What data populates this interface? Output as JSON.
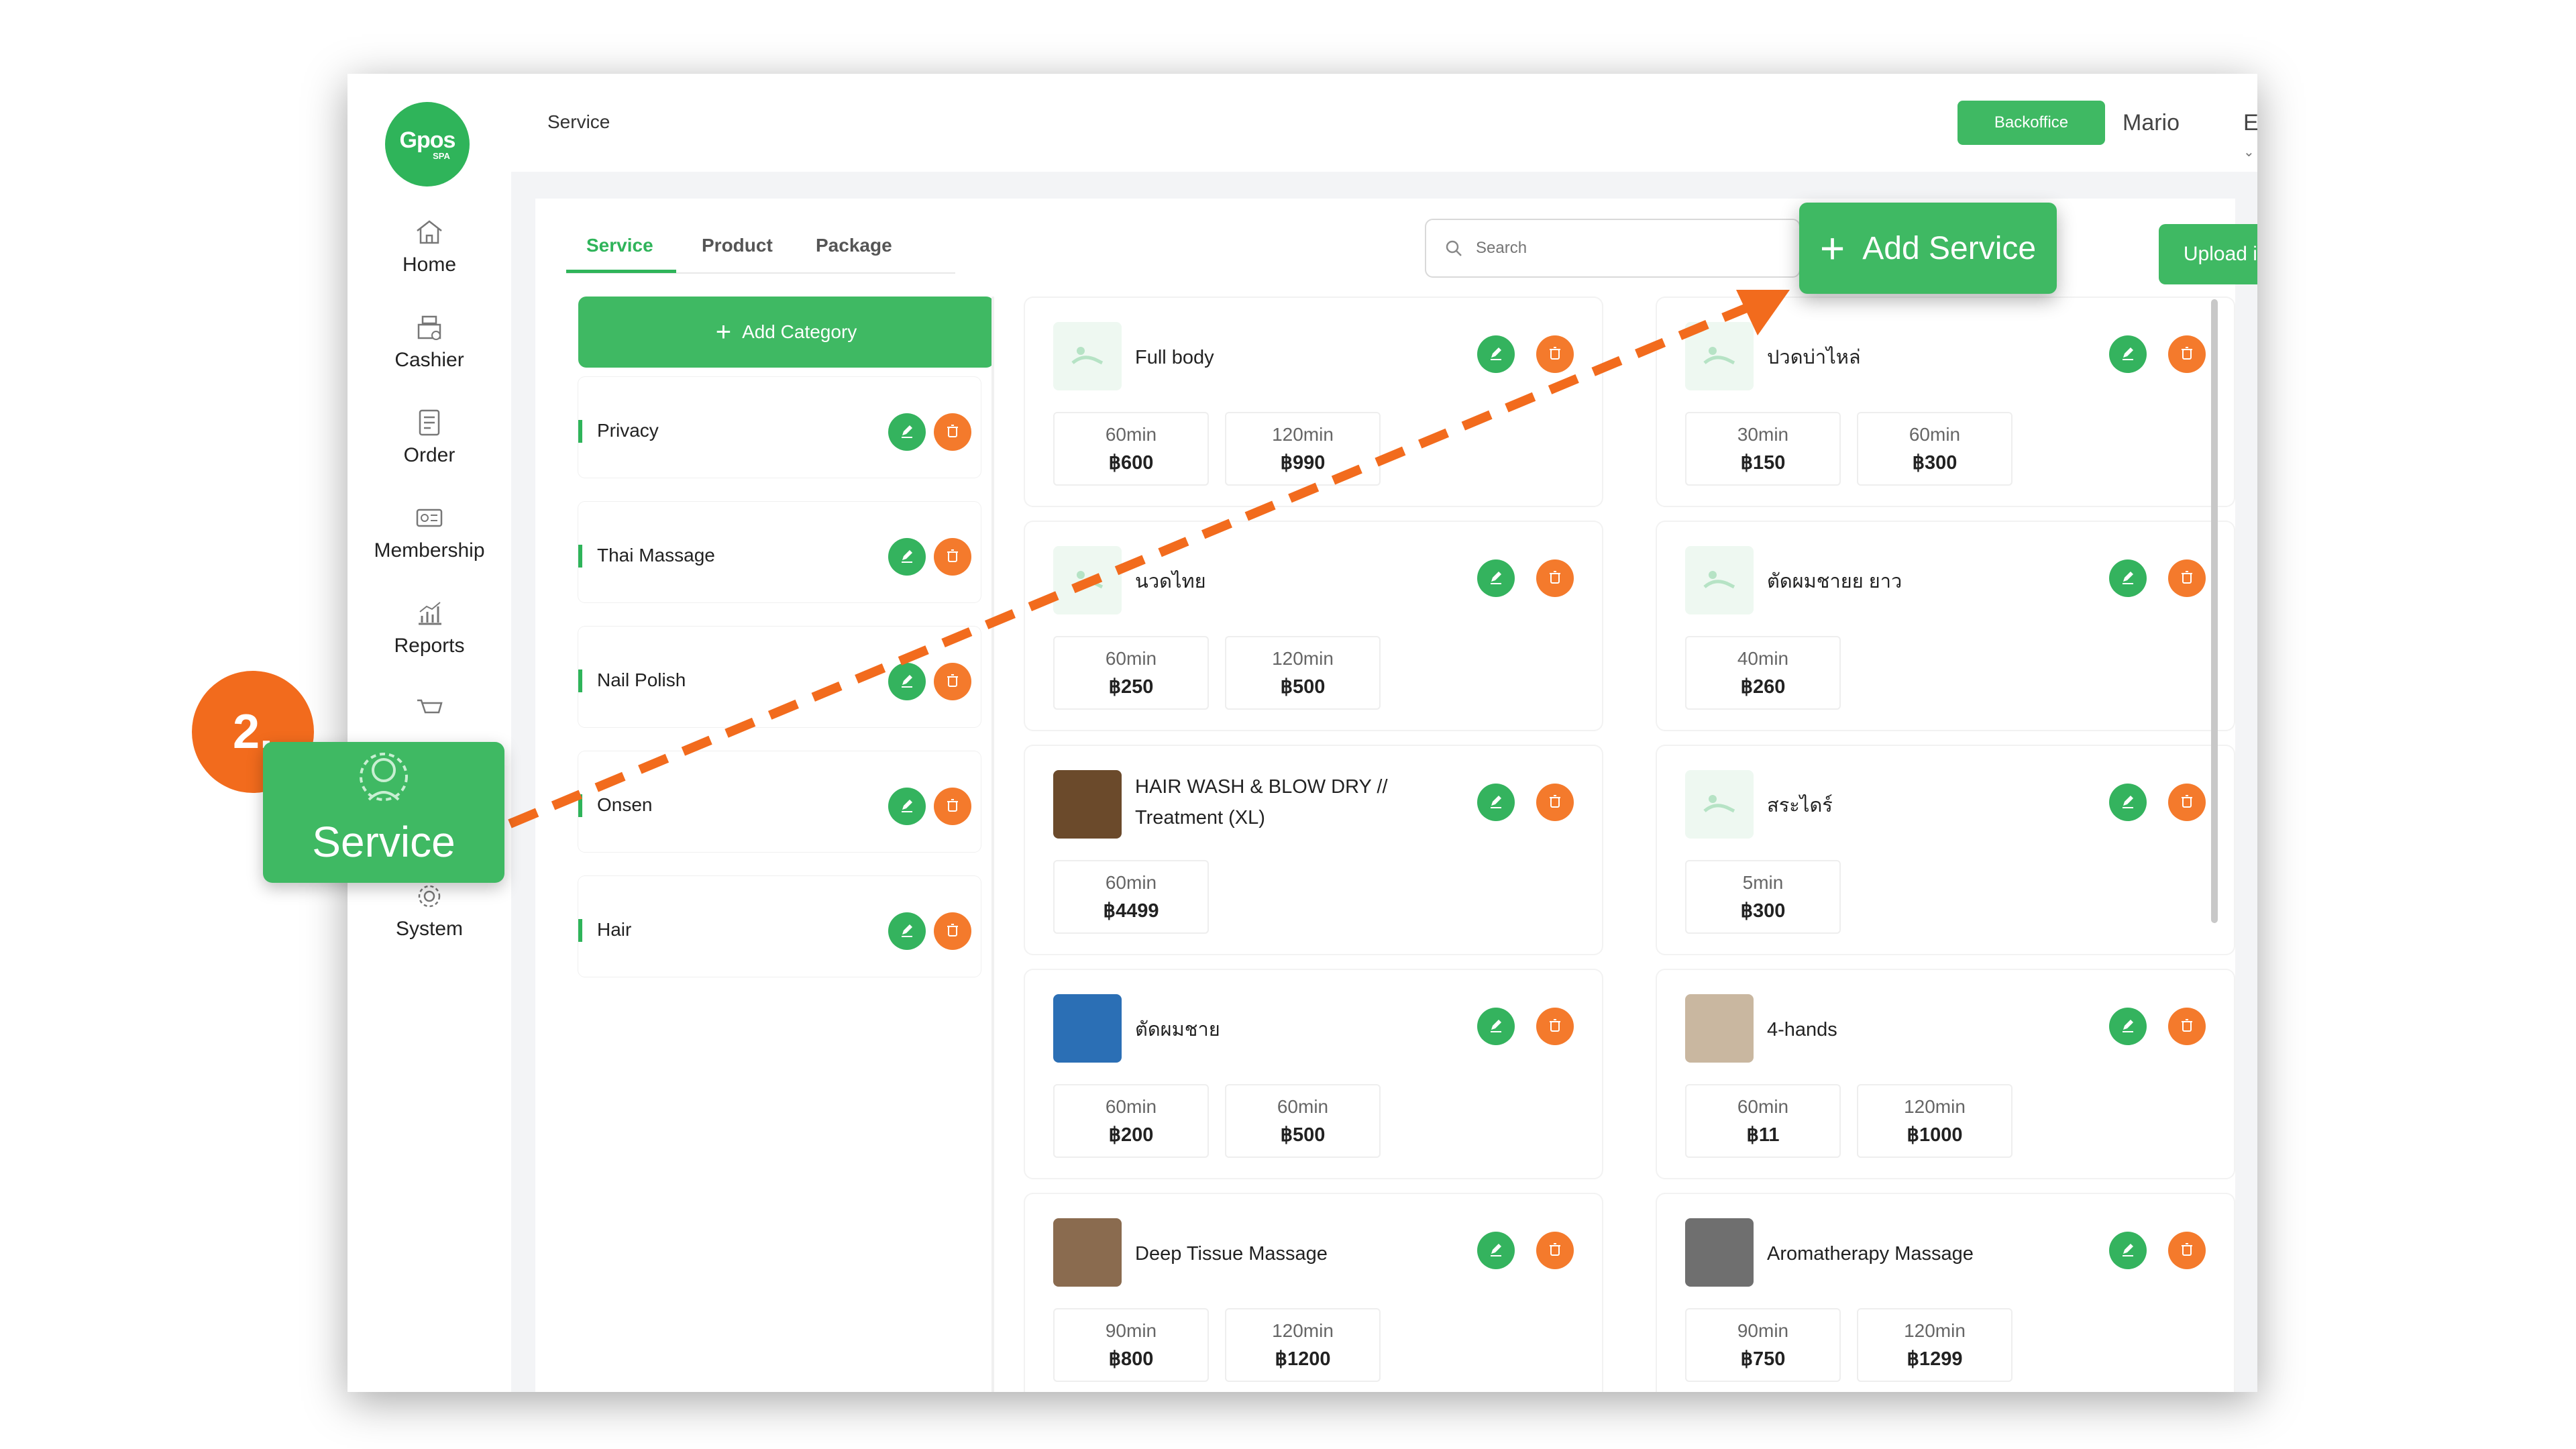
{
  "sidebar": {
    "logo": {
      "brand": "Gpos",
      "sub": "SPA"
    },
    "items": [
      {
        "label": "Home",
        "icon": "home-icon"
      },
      {
        "label": "Cashier",
        "icon": "cashier-icon"
      },
      {
        "label": "Order",
        "icon": "order-icon"
      },
      {
        "label": "Membership",
        "icon": "membership-icon"
      },
      {
        "label": "Reports",
        "icon": "reports-icon"
      },
      {
        "label": "System",
        "icon": "gear-icon"
      }
    ]
  },
  "header": {
    "title": "Service",
    "backoffice_label": "Backoffice",
    "user": "Mario",
    "language": "EN"
  },
  "tabs": [
    {
      "label": "Service",
      "active": true
    },
    {
      "label": "Product",
      "active": false
    },
    {
      "label": "Package",
      "active": false
    }
  ],
  "search": {
    "placeholder": "Search"
  },
  "upload_label": "Upload image",
  "add_category_label": "Add Category",
  "categories": [
    "Privacy",
    "Thai Massage",
    "Nail Polish",
    "Onsen",
    "Hair"
  ],
  "services": [
    {
      "name": "Full body",
      "options": [
        {
          "dur": "60min",
          "price": "฿600"
        },
        {
          "dur": "120min",
          "price": "฿990"
        }
      ]
    },
    {
      "name": "ปวดบ่าไหล่",
      "options": [
        {
          "dur": "30min",
          "price": "฿150"
        },
        {
          "dur": "60min",
          "price": "฿300"
        }
      ]
    },
    {
      "name": "นวดไทย",
      "options": [
        {
          "dur": "60min",
          "price": "฿250"
        },
        {
          "dur": "120min",
          "price": "฿500"
        }
      ]
    },
    {
      "name": "ตัดผมชายย ยาว",
      "options": [
        {
          "dur": "40min",
          "price": "฿260"
        }
      ]
    },
    {
      "name": "HAIR WASH & BLOW DRY // Treatment (XL)",
      "options": [
        {
          "dur": "60min",
          "price": "฿4499"
        }
      ]
    },
    {
      "name": "สระไดร์",
      "options": [
        {
          "dur": "5min",
          "price": "฿300"
        }
      ]
    },
    {
      "name": "ตัดผมชาย",
      "options": [
        {
          "dur": "60min",
          "price": "฿200"
        },
        {
          "dur": "60min",
          "price": "฿500"
        }
      ]
    },
    {
      "name": "4-hands",
      "options": [
        {
          "dur": "60min",
          "price": "฿11"
        },
        {
          "dur": "120min",
          "price": "฿1000"
        }
      ]
    },
    {
      "name": "Deep Tissue Massage",
      "options": [
        {
          "dur": "90min",
          "price": "฿800"
        },
        {
          "dur": "120min",
          "price": "฿1200"
        }
      ]
    },
    {
      "name": "Aromatherapy Massage",
      "options": [
        {
          "dur": "90min",
          "price": "฿750"
        },
        {
          "dur": "120min",
          "price": "฿1299"
        }
      ]
    }
  ],
  "overlay": {
    "step": "2.",
    "service_callout": "Service",
    "add_service_callout": "Add Service"
  },
  "colors": {
    "brand_green": "#3fb963",
    "accent_orange": "#f47a2c"
  }
}
